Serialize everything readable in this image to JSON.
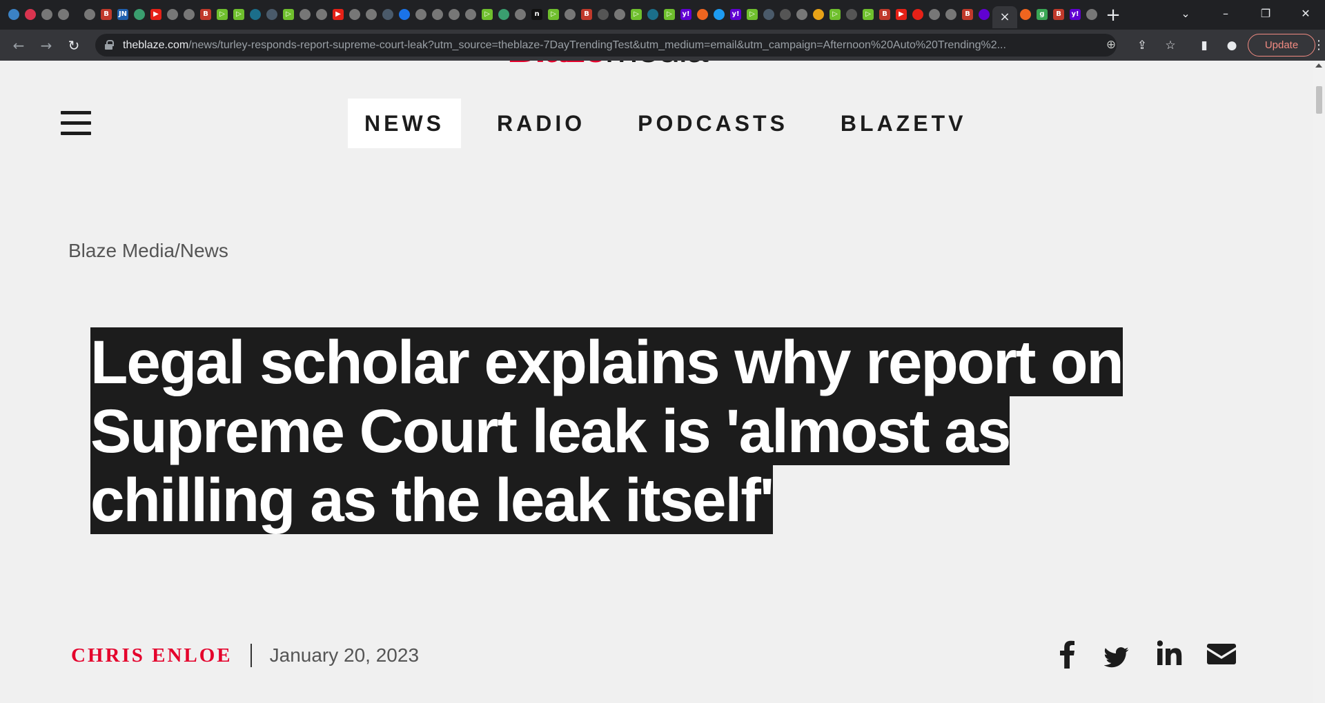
{
  "browser": {
    "active_tab_close": "×",
    "new_tab": "+",
    "tab_search": "⌄",
    "minimize": "–",
    "restore": "❐",
    "close": "✕",
    "back": "←",
    "forward": "→",
    "reload": "↻",
    "url_host": "theblaze.com",
    "url_path": "/news/turley-responds-report-supreme-court-leak?utm_source=theblaze-7DayTrendingTest&utm_medium=email&utm_campaign=Afternoon%20Auto%20Trending%2...",
    "zoom_icon": "⊕",
    "share_icon": "⇪",
    "star_icon": "☆",
    "sidepanel_icon": "▮",
    "profile_icon": "●",
    "update_label": "Update",
    "menu_icon": "⋮",
    "tab_favicons": [
      {
        "glyph": "",
        "color": "#3b82c4"
      },
      {
        "glyph": "",
        "color": "#d9344f"
      },
      {
        "glyph": "",
        "color": "#777"
      },
      {
        "glyph": "",
        "color": "#777"
      },
      {
        "sep": true
      },
      {
        "glyph": "",
        "color": "#777"
      },
      {
        "glyph": "B",
        "color": "#c0392b"
      },
      {
        "glyph": "JN",
        "color": "#1f5fae"
      },
      {
        "glyph": "",
        "color": "#3a9e6f"
      },
      {
        "glyph": "▶",
        "color": "#e62117"
      },
      {
        "glyph": "",
        "color": "#777"
      },
      {
        "glyph": "",
        "color": "#777"
      },
      {
        "glyph": "B",
        "color": "#c0392b"
      },
      {
        "glyph": "▷",
        "color": "#6fbf2d"
      },
      {
        "glyph": "▷",
        "color": "#6fbf2d"
      },
      {
        "glyph": "",
        "color": "#1b6e8a"
      },
      {
        "glyph": "",
        "color": "#4a5a6a"
      },
      {
        "glyph": "▷",
        "color": "#6fbf2d"
      },
      {
        "glyph": "",
        "color": "#777"
      },
      {
        "glyph": "",
        "color": "#777"
      },
      {
        "glyph": "▶",
        "color": "#e62117"
      },
      {
        "glyph": "",
        "color": "#777"
      },
      {
        "glyph": "",
        "color": "#777"
      },
      {
        "glyph": "",
        "color": "#4a5a6a"
      },
      {
        "glyph": "",
        "color": "#1a73e8"
      },
      {
        "glyph": "",
        "color": "#777"
      },
      {
        "glyph": "",
        "color": "#777"
      },
      {
        "glyph": "",
        "color": "#777"
      },
      {
        "glyph": "",
        "color": "#777"
      },
      {
        "glyph": "▷",
        "color": "#6fbf2d"
      },
      {
        "glyph": "",
        "color": "#3a9e6f"
      },
      {
        "glyph": "",
        "color": "#777"
      },
      {
        "glyph": "n",
        "color": "#111"
      },
      {
        "glyph": "▷",
        "color": "#6fbf2d"
      },
      {
        "glyph": "",
        "color": "#777"
      },
      {
        "glyph": "B",
        "color": "#c0392b"
      },
      {
        "glyph": "",
        "color": "#555"
      },
      {
        "glyph": "",
        "color": "#777"
      },
      {
        "glyph": "▷",
        "color": "#6fbf2d"
      },
      {
        "glyph": "",
        "color": "#1b6e8a"
      },
      {
        "glyph": "▷",
        "color": "#6fbf2d"
      },
      {
        "glyph": "y!",
        "color": "#6001d2"
      },
      {
        "glyph": "",
        "color": "#f0651f"
      },
      {
        "glyph": "",
        "color": "#1d9bf0"
      },
      {
        "glyph": "y!",
        "color": "#6001d2"
      },
      {
        "glyph": "▷",
        "color": "#6fbf2d"
      },
      {
        "glyph": "",
        "color": "#4a5a6a"
      },
      {
        "glyph": "",
        "color": "#555"
      },
      {
        "glyph": "",
        "color": "#777"
      },
      {
        "glyph": "",
        "color": "#e8a317"
      },
      {
        "glyph": "▷",
        "color": "#6fbf2d"
      },
      {
        "glyph": "",
        "color": "#555"
      },
      {
        "glyph": "▷",
        "color": "#6fbf2d"
      },
      {
        "glyph": "B",
        "color": "#c0392b"
      },
      {
        "glyph": "▶",
        "color": "#e62117"
      },
      {
        "glyph": "",
        "color": "#e62117"
      },
      {
        "glyph": "",
        "color": "#777"
      },
      {
        "glyph": "",
        "color": "#777"
      },
      {
        "glyph": "B",
        "color": "#c0392b"
      },
      {
        "glyph": "",
        "color": "#6001d2"
      },
      {
        "active": true
      },
      {
        "glyph": "",
        "color": "#f0651f"
      },
      {
        "glyph": "g",
        "color": "#3aa655"
      },
      {
        "glyph": "B",
        "color": "#c0392b"
      },
      {
        "glyph": "y!",
        "color": "#6001d2"
      },
      {
        "glyph": "",
        "color": "#777"
      }
    ]
  },
  "site": {
    "logo_part1": "Blaze",
    "logo_part2": "media",
    "nav": [
      {
        "label": "NEWS",
        "active": true
      },
      {
        "label": "RADIO",
        "active": false
      },
      {
        "label": "PODCASTS",
        "active": false
      },
      {
        "label": "BLAZETV",
        "active": false
      }
    ]
  },
  "article": {
    "breadcrumb": "Blaze Media/News",
    "headline": "Legal scholar explains why report on Supreme Court leak is 'almost as chilling as the leak itself'",
    "author": "CHRIS ENLOE",
    "date": "January 20, 2023"
  },
  "share_icons": [
    "facebook-icon",
    "twitter-icon",
    "linkedin-icon",
    "email-icon"
  ],
  "colors": {
    "brand_red": "#e4002b",
    "headline_bg": "#1c1c1c",
    "page_bg": "#f0f0f0"
  }
}
